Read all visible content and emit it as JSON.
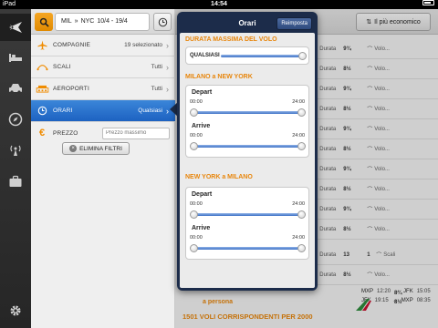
{
  "status": {
    "device": "iPad",
    "time": "14:54"
  },
  "rail": {
    "items": [
      "plane-icon",
      "bed-icon",
      "car-icon",
      "compass-icon",
      "signal-icon",
      "briefcase-icon",
      "gear-icon"
    ]
  },
  "filter": {
    "route_from": "MIL",
    "route_sep": "»",
    "route_to": "NYC",
    "dates": "10/4 - 19/4",
    "rows": [
      {
        "label": "COMPAGNIE",
        "value": "19 selezionato"
      },
      {
        "label": "SCALI",
        "value": "Tutti"
      },
      {
        "label": "AEROPORTI",
        "value": "Tutti"
      },
      {
        "label": "ORARI",
        "value": "Qualsiasi"
      },
      {
        "label": "PREZZO",
        "placeholder": "Prezzo massimo"
      }
    ],
    "clear_label": "ELIMINA FILTRI"
  },
  "results": {
    "sort_label": "Il più economico",
    "rows": [
      {
        "duration_label": "Durata",
        "duration": "9¾",
        "type": "Volo..."
      },
      {
        "duration_label": "Durata",
        "duration": "8½",
        "type": "Volo..."
      },
      {
        "duration_label": "Durata",
        "duration": "9¾",
        "type": "Volo..."
      },
      {
        "duration_label": "Durata",
        "duration": "8½",
        "type": "Volo..."
      },
      {
        "duration_label": "Durata",
        "duration": "9¾",
        "type": "Volo..."
      },
      {
        "duration_label": "Durata",
        "duration": "8½",
        "type": "Volo..."
      },
      {
        "duration_label": "Durata",
        "duration": "9¾",
        "type": "Volo..."
      },
      {
        "duration_label": "Durata",
        "duration": "8½",
        "type": "Volo..."
      },
      {
        "duration_label": "Durata",
        "duration": "9¾",
        "type": "Volo..."
      },
      {
        "duration_label": "Durata",
        "duration": "8½",
        "type": "Volo..."
      },
      {
        "duration_label": "Durata",
        "duration": "13",
        "type": "Scali",
        "stops": "1"
      },
      {
        "duration_label": "Durata",
        "duration": "8½",
        "type": "Volo..."
      }
    ],
    "flight_lines": [
      {
        "from": "MXP",
        "dep": "12:20",
        "to": "JFK",
        "arr": "15:05"
      },
      {
        "from": "JFK",
        "dep": "19:15",
        "to": "MXP",
        "arr": "08:35"
      }
    ],
    "durations_bottom": [
      "8¾",
      "8½"
    ],
    "price_note": "a persona",
    "footer": "1501 VOLI CORRISPONDENTI PER 2000"
  },
  "popover": {
    "title": "Orari",
    "reset_label": "Reimposta",
    "max_duration": {
      "title": "DURATA MASSIMA DEL VOLO",
      "value": "QUALSIASI",
      "level": 1.0
    },
    "sections": [
      {
        "title": "MILANO a NEW YORK",
        "sliders": [
          {
            "label": "Depart",
            "min": "00:00",
            "max": "24:00",
            "from": 0,
            "to": 1
          },
          {
            "label": "Arrive",
            "min": "00:00",
            "max": "24:00",
            "from": 0,
            "to": 1
          }
        ]
      },
      {
        "title": "NEW YORK a MILANO",
        "sliders": [
          {
            "label": "Depart",
            "min": "00:00",
            "max": "24:00",
            "from": 0,
            "to": 1
          },
          {
            "label": "Arrive",
            "min": "00:00",
            "max": "24:00",
            "from": 0,
            "to": 1
          }
        ]
      }
    ]
  }
}
